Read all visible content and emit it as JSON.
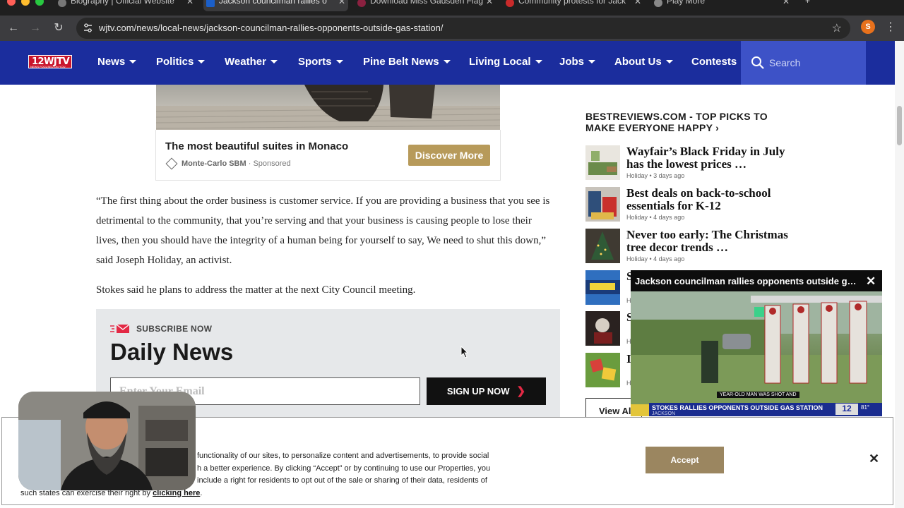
{
  "browser": {
    "tabs": [
      {
        "title": "Biography | Official Website",
        "active": false
      },
      {
        "title": "Jackson councilman rallies o",
        "active": true
      },
      {
        "title": "Download Miss Gadsden Flag",
        "active": false
      },
      {
        "title": "Community protests for Jack",
        "active": false
      },
      {
        "title": "Play More",
        "active": false
      }
    ],
    "url": "wjtv.com/news/local-news/jackson-councilman-rallies-opponents-outside-gas-station/",
    "profile_initial": "S"
  },
  "site": {
    "logo_text": "12WJTV",
    "logo_sub": "NEWS FOCUSED ON YOU",
    "nav": [
      "News",
      "Politics",
      "Weather",
      "Sports",
      "Pine Belt News",
      "Living Local",
      "Jobs",
      "About Us",
      "Contests"
    ],
    "search_placeholder": "Search"
  },
  "ad": {
    "title": "The most beautiful suites in Monaco",
    "source": "Monte-Carlo SBM",
    "sponsored": "· Sponsored",
    "button": "Discover More"
  },
  "article": {
    "paragraph1": "“The first thing about the order business is customer service. If you are providing a business that you see is detrimental to the community, that you’re serving and that your business is causing people to lose their lives, then you should have the integrity of a human being for yourself to say, We need to shut this down,” said Joseph Holiday, an activist.",
    "paragraph2": "Stokes said he plans to address the matter at the next City Council meeting."
  },
  "subscribe": {
    "label": "SUBSCRIBE NOW",
    "title": "Daily News",
    "email_placeholder": "Enter Your Email",
    "button": "SIGN UP NOW"
  },
  "sidebar": {
    "title": "BESTREVIEWS.COM - TOP PICKS TO MAKE EVERYONE HAPPY ›",
    "items": [
      {
        "headline": "Wayfair’s Black Friday in July has the lowest prices …",
        "meta": "Holiday • 3 days ago"
      },
      {
        "headline": "Best deals on back-to-school essentials for K-12",
        "meta": "Holiday • 4 days ago"
      },
      {
        "headline": "Never too early: The Christmas tree decor trends …",
        "meta": "Holiday • 4 days ago"
      },
      {
        "headline": "S",
        "meta": "H"
      },
      {
        "headline": "S",
        "meta": "H"
      },
      {
        "headline": "I",
        "meta": "H"
      }
    ],
    "view_all": "View Al"
  },
  "video": {
    "title": "Jackson councilman rallies opponents outside g…",
    "caption": "YEAR-OLD MAN WAS SHOT AND",
    "lower_third": "STOKES RALLIES OPPONENTS OUTSIDE GAS STATION",
    "lower_sub": "JACKSON",
    "channel": "12",
    "temp": "81°"
  },
  "cookie": {
    "line1": "functionality of our sites, to personalize content and advertisements, to provide social",
    "line2": "h a better experience. By clicking “Accept” or by continuing to use our Properties, you",
    "line3": "include a right for residents to opt out of the sale or sharing of their data, residents of",
    "line4": "such states can exercise their right by",
    "link": "clicking here",
    "accept": "Accept"
  },
  "colors": {
    "nav_bg": "#1b2d9d",
    "search_bg": "#3d52c7",
    "ad_button": "#b79a5a",
    "accept_button": "#9b8660",
    "logo_red": "#c9142b"
  }
}
